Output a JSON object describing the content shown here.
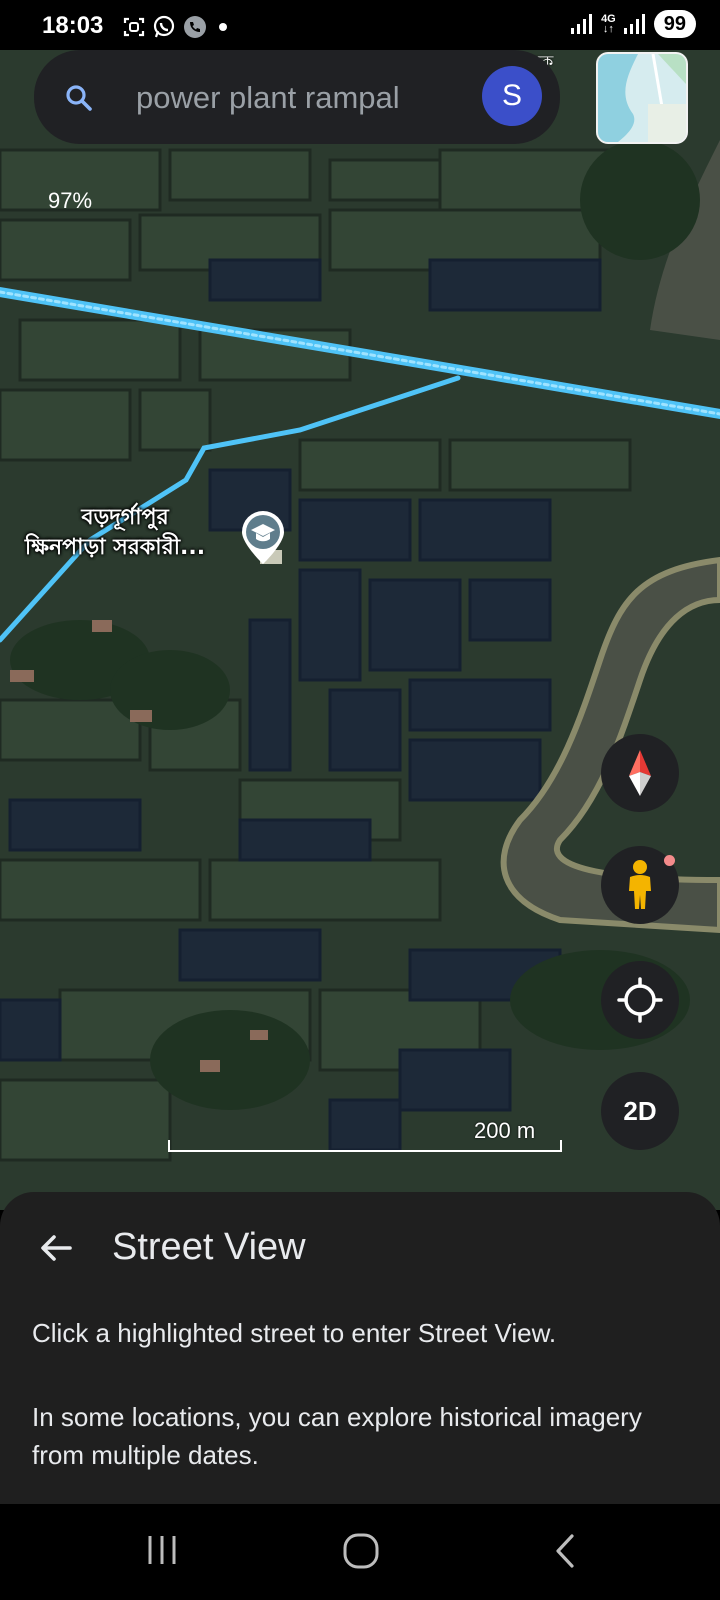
{
  "status_bar": {
    "time": "18:03",
    "network": "4G",
    "battery": "99",
    "icons": [
      "screenshot-icon",
      "whatsapp-icon",
      "phone-icon",
      "dot-icon",
      "signal-icon",
      "signal-icon"
    ]
  },
  "search": {
    "query": "power plant rampal",
    "avatar_initial": "S"
  },
  "map": {
    "zoom_percent": "97%",
    "place_label_line1": "বড়দূর্গাপুর",
    "place_label_line2": "ক্ষিনপাড়া সরকারী...",
    "edge_label": "নমক",
    "scale_label": "200 m",
    "accent_color": "#4fc3f7",
    "compass_color": "#e53935",
    "pegman_color": "#f4b400"
  },
  "map_controls": {
    "compass": "compass-icon",
    "pegman": "pegman-icon",
    "locate": "my-location-icon",
    "view_mode": "2D"
  },
  "sheet": {
    "title": "Street View",
    "paragraph1": "Click a highlighted street to enter Street View.",
    "paragraph2": "In some locations, you can explore historical imagery from multiple dates."
  },
  "nav_bar": {
    "buttons": [
      "recents-icon",
      "home-icon",
      "back-icon"
    ]
  }
}
